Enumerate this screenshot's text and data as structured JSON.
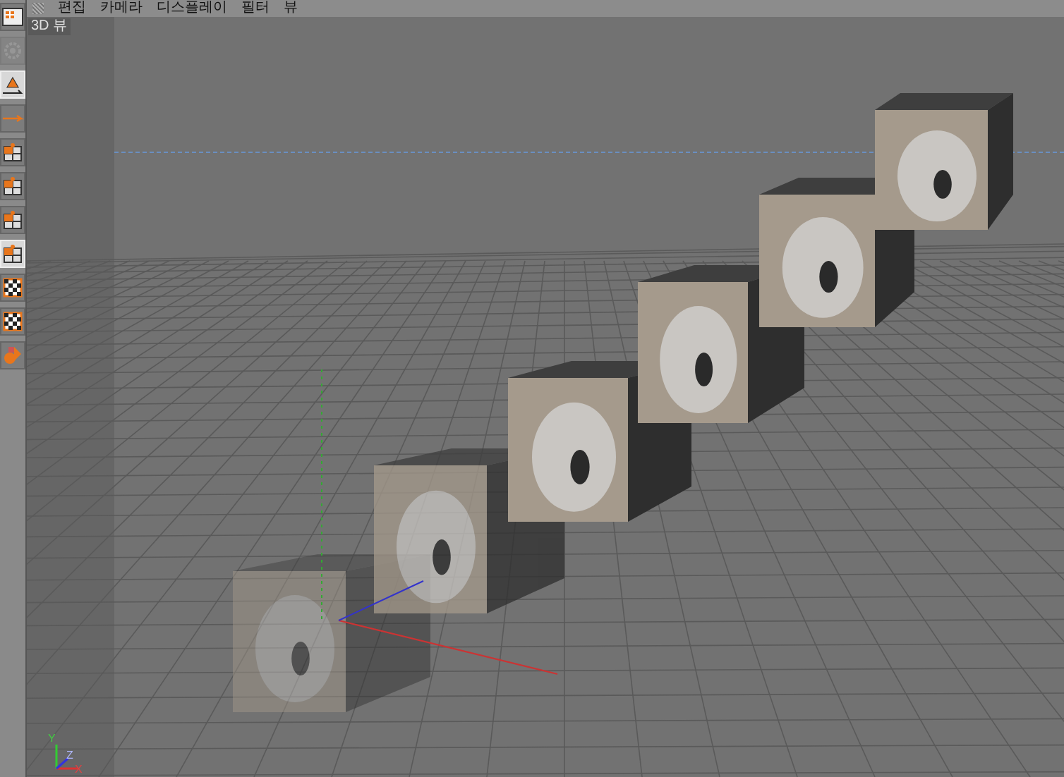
{
  "menu_bar": {
    "items": [
      "편집",
      "카메라",
      "디스플레이",
      "필터",
      "뷰"
    ]
  },
  "viewport": {
    "title": "3D 뷰",
    "axis_labels": [
      "Y",
      "Z",
      "X"
    ]
  },
  "toolbar": [
    {
      "kind": "layout",
      "selected": false,
      "disabled": false
    },
    {
      "kind": "gear",
      "selected": false,
      "disabled": true
    },
    {
      "kind": "cone",
      "selected": true,
      "disabled": false
    },
    {
      "kind": "arrow",
      "selected": false,
      "disabled": false
    },
    {
      "kind": "grid",
      "selected": false,
      "disabled": false
    },
    {
      "kind": "grid",
      "selected": false,
      "disabled": false
    },
    {
      "kind": "grid",
      "selected": false,
      "disabled": false
    },
    {
      "kind": "grid",
      "selected": true,
      "disabled": false
    },
    {
      "kind": "checker",
      "selected": false,
      "disabled": false
    },
    {
      "kind": "checker",
      "selected": false,
      "disabled": false
    },
    {
      "kind": "shapes",
      "selected": false,
      "disabled": false
    }
  ]
}
